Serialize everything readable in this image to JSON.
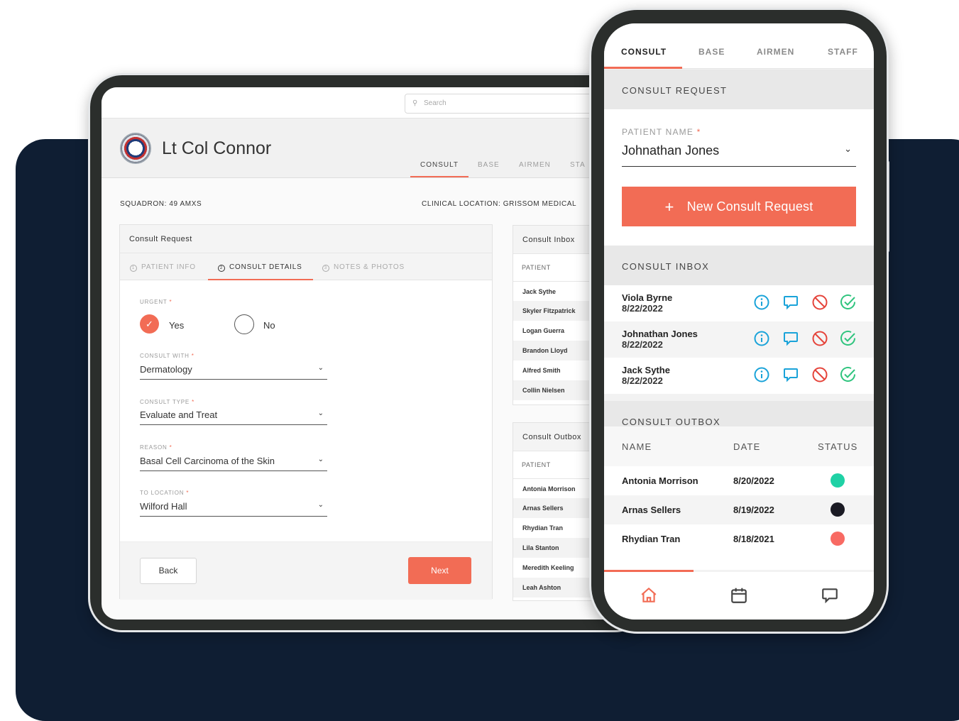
{
  "colors": {
    "accent": "#f26c55",
    "navy": "#0f1e33",
    "info": "#1aa3d9",
    "chat": "#1aa3d9",
    "decline": "#e5443b",
    "approve": "#2fc47e"
  },
  "tablet": {
    "search_placeholder": "Search",
    "user_name": "Lt Col Connor",
    "tabs": [
      "CONSULT",
      "BASE",
      "AIRMEN",
      "STA"
    ],
    "squadron": "SQUADRON: 49 AMXS",
    "clinical_location": "CLINICAL LOCATION: GRISSOM MEDICAL",
    "request": {
      "title": "Consult Request",
      "steps": [
        {
          "num": "1",
          "label": "PATIENT INFO"
        },
        {
          "num": "2",
          "label": "CONSULT DETAILS"
        },
        {
          "num": "3",
          "label": "NOTES & PHOTOS"
        }
      ],
      "urgent_label": "URGENT",
      "required_mark": "*",
      "yes_label": "Yes",
      "no_label": "No",
      "consult_with_label": "CONSULT WITH",
      "consult_with_value": "Dermatology",
      "consult_type_label": "CONSULT TYPE",
      "consult_type_value": "Evaluate and Treat",
      "reason_label": "REASON",
      "reason_value": "Basal Cell Carcinoma of the Skin",
      "to_location_label": "TO LOCATION",
      "to_location_value": "Wilford Hall",
      "back_label": "Back",
      "next_label": "Next"
    },
    "inbox": {
      "title": "Consult Inbox",
      "column": "PATIENT",
      "rows": [
        "Jack Sythe",
        "Skyler Fitzpatrick",
        "Logan Guerra",
        "Brandon Lloyd",
        "Alfred Smith",
        "Collin Nielsen"
      ]
    },
    "outbox": {
      "title": "Consult Outbox",
      "column": "PATIENT",
      "rows": [
        "Antonia Morrison",
        "Arnas Sellers",
        "Rhydian Tran",
        "Lila Stanton",
        "Meredith Keeling",
        "Leah Ashton"
      ]
    }
  },
  "phone": {
    "tabs": [
      "CONSULT",
      "BASE",
      "AIRMEN",
      "STAFF"
    ],
    "request_section": "CONSULT REQUEST",
    "patient_name_label": "PATIENT NAME",
    "required_mark": "*",
    "patient_name_value": "Johnathan Jones",
    "new_button_plus": "+",
    "new_button_label": "New Consult Request",
    "inbox_section": "CONSULT INBOX",
    "inbox_rows": [
      {
        "name": "Viola Byrne",
        "date": "8/22/2022"
      },
      {
        "name": "Johnathan Jones",
        "date": "8/22/2022"
      },
      {
        "name": "Jack Sythe",
        "date": "8/22/2022"
      }
    ],
    "outbox_section": "CONSULT OUTBOX",
    "outbox_columns": [
      "NAME",
      "DATE",
      "STATUS"
    ],
    "outbox_rows": [
      {
        "name": "Antonia Morrison",
        "date": "8/20/2022",
        "status_color": "#1fd1a5"
      },
      {
        "name": "Arnas Sellers",
        "date": "8/19/2022",
        "status_color": "#1b1b24"
      },
      {
        "name": "Rhydian Tran",
        "date": "8/18/2021",
        "status_color": "#f86a63"
      }
    ],
    "bottom_nav": [
      "home-icon",
      "calendar-icon",
      "chat-icon"
    ]
  }
}
